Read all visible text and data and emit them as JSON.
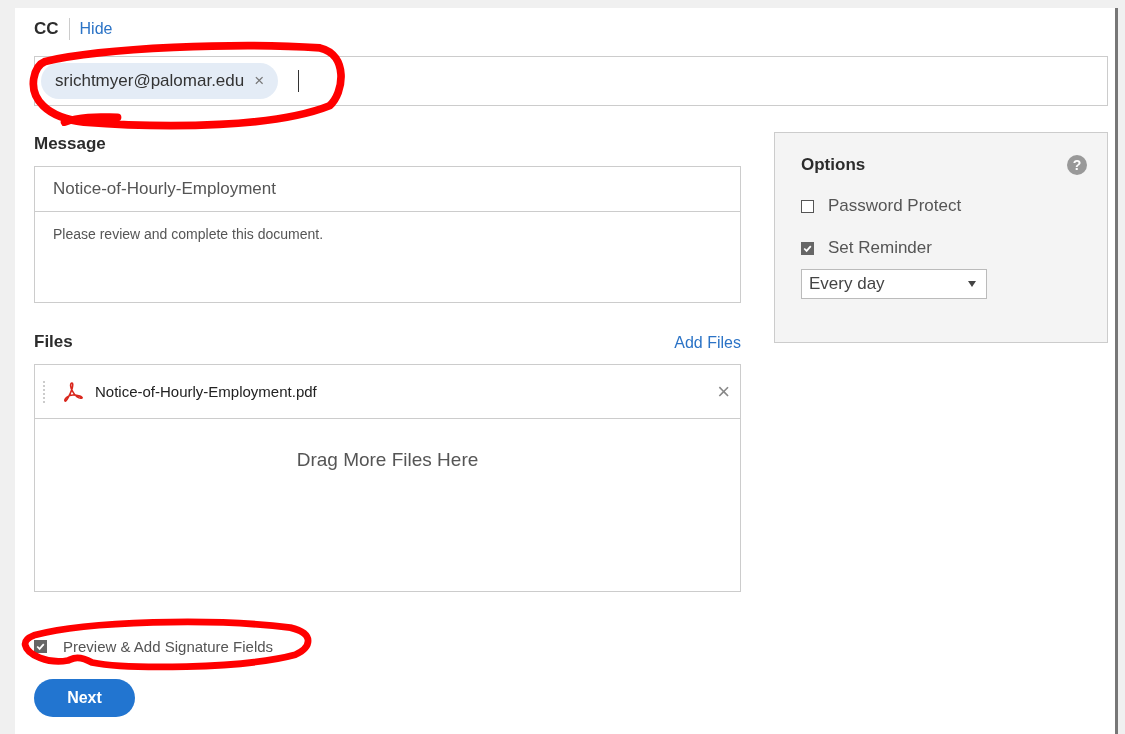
{
  "cc": {
    "label": "CC",
    "hide_link": "Hide",
    "recipients": [
      {
        "email": "srichtmyer@palomar.edu",
        "remove": "×"
      }
    ],
    "highlighted": true
  },
  "message": {
    "label": "Message",
    "subject": "Notice-of-Hourly-Employment",
    "body": "Please review and complete this document."
  },
  "files": {
    "label": "Files",
    "add_link": "Add Files",
    "items": [
      {
        "name": "Notice-of-Hourly-Employment.pdf",
        "remove": "×"
      }
    ],
    "drop_hint": "Drag More Files Here"
  },
  "options": {
    "title": "Options",
    "help": "?",
    "items": [
      {
        "label": "Password Protect",
        "checked": false
      },
      {
        "label": "Set Reminder",
        "checked": true
      }
    ],
    "reminder_select": "Every day"
  },
  "preview": {
    "label": "Preview & Add Signature Fields",
    "checked": true,
    "highlighted": true
  },
  "next_button": "Next"
}
